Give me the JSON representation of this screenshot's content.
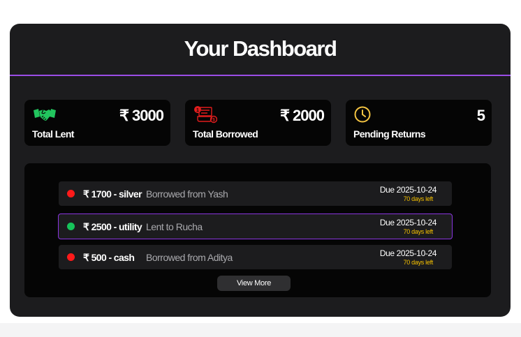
{
  "header": {
    "title": "Your Dashboard"
  },
  "stats": [
    {
      "label": "Total Lent",
      "value": "₹ 3000",
      "icon": "handshake-icon",
      "icon_color": "#22c55e"
    },
    {
      "label": "Total Borrowed",
      "value": "₹ 2000",
      "icon": "debt-icon",
      "icon_color": "#e11d1d"
    },
    {
      "label": "Pending Returns",
      "value": "5",
      "icon": "clock-icon",
      "icon_color": "#f5c542"
    }
  ],
  "transactions": [
    {
      "amount": "₹ 1700 - silver",
      "party": "Borrowed from Yash",
      "due": "Due 2025-10-24",
      "days_left": "70 days left",
      "status_color": "#ff1a1a"
    },
    {
      "amount": "₹ 2500 - utility",
      "party": "Lent to Rucha",
      "due": "Due 2025-10-24",
      "days_left": "70 days left",
      "status_color": "#16c35a"
    },
    {
      "amount": "₹ 500 - cash",
      "party": "Borrowed from Aditya",
      "due": "Due 2025-10-24",
      "days_left": "70 days left",
      "status_color": "#ff1a1a"
    }
  ],
  "view_more_label": "View More",
  "colors": {
    "panel": "#1c1c1e",
    "accent": "#9b4de6",
    "card": "#050505",
    "due_soon": "#f5c000"
  }
}
